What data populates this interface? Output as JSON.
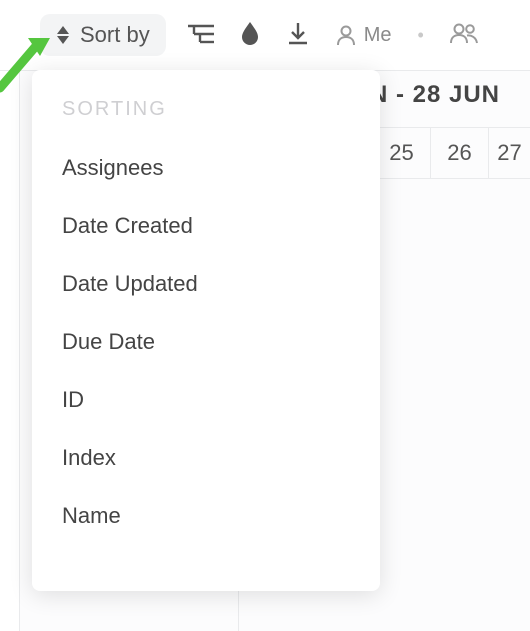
{
  "toolbar": {
    "sort_by_label": "Sort by",
    "me_label": "Me"
  },
  "date_header": {
    "range_label": "N - 28 JUN",
    "days": [
      "25",
      "26",
      "27"
    ]
  },
  "sort_menu": {
    "heading": "SORTING",
    "items": [
      "Assignees",
      "Date Created",
      "Date Updated",
      "Due Date",
      "ID",
      "Index",
      "Name"
    ]
  },
  "colors": {
    "arrow": "#55C63F"
  }
}
